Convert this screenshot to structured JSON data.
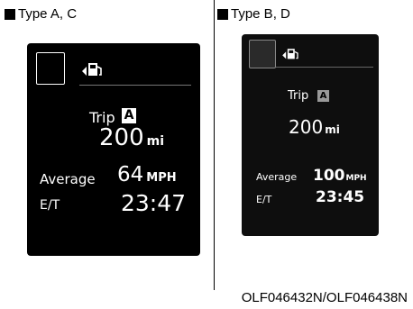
{
  "left": {
    "heading": "Type A, C",
    "trip_label": "Trip",
    "trip_letter": "A",
    "distance_value": "200",
    "distance_unit": "mi",
    "average_label": "Average",
    "average_value": "64",
    "average_unit": "MPH",
    "et_label": "E/T",
    "et_value": "23:47"
  },
  "right": {
    "heading": "Type B, D",
    "trip_label": "Trip",
    "trip_letter": "A",
    "distance_value": "200",
    "distance_unit": "mi",
    "average_label": "Average",
    "average_value": "100",
    "average_unit": "MPH",
    "et_label": "E/T",
    "et_value": "23:45"
  },
  "caption": "OLF046432N/OLF046438N",
  "colors": {
    "page_background": "#ffffff",
    "display_background": "#000000",
    "display_text": "#ffffff"
  }
}
